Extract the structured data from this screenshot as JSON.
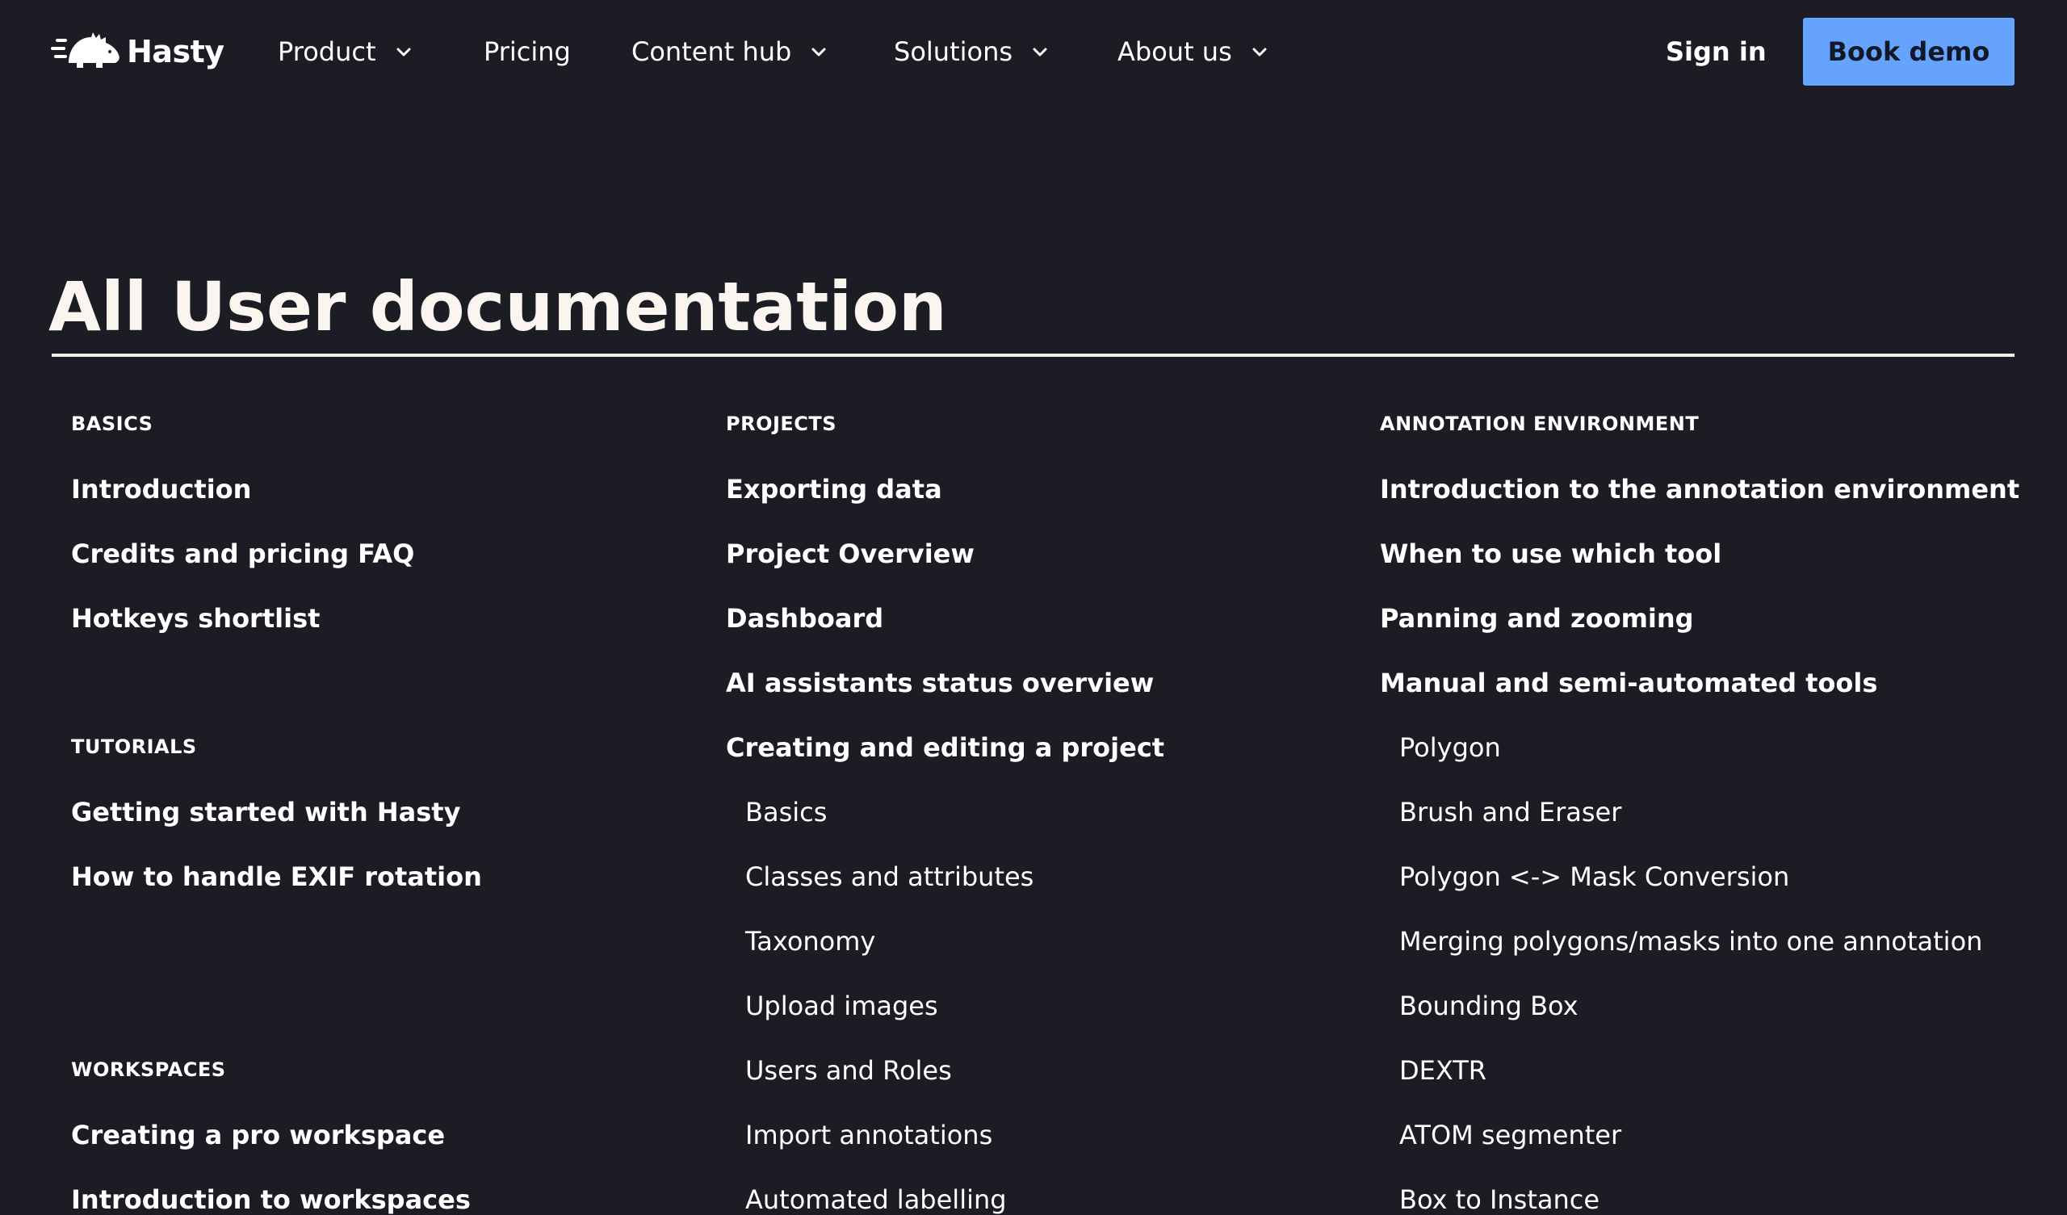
{
  "nav": {
    "logo_text": "Hasty",
    "items": [
      {
        "label": "Product",
        "has_dropdown": true
      },
      {
        "label": "Pricing",
        "has_dropdown": false
      },
      {
        "label": "Content hub",
        "has_dropdown": true
      },
      {
        "label": "Solutions",
        "has_dropdown": true
      },
      {
        "label": "About us",
        "has_dropdown": true
      }
    ],
    "sign_in": "Sign in",
    "book_demo": "Book demo"
  },
  "page": {
    "title": "All User documentation"
  },
  "colors": {
    "background": "#1b1c24",
    "accent": "#66a3ff",
    "title": "#fbf5ef"
  },
  "columns": [
    {
      "sections": [
        {
          "heading": "BASICS",
          "links": [
            "Introduction",
            "Credits and pricing FAQ",
            "Hotkeys shortlist"
          ]
        },
        {
          "heading": "TUTORIALS",
          "links": [
            "Getting started with Hasty",
            "How to handle EXIF rotation"
          ]
        },
        {
          "heading": "WORKSPACES",
          "links": [
            "Creating a pro workspace",
            "Introduction to workspaces"
          ]
        }
      ]
    },
    {
      "sections": [
        {
          "heading": "PROJECTS",
          "links": [
            "Exporting data",
            "Project Overview",
            "Dashboard",
            "AI assistants status overview",
            "Creating and editing a project"
          ],
          "sublinks": [
            "Basics",
            "Classes and attributes",
            "Taxonomy",
            "Upload images",
            "Users and Roles",
            "Import annotations",
            "Automated labelling"
          ]
        }
      ]
    },
    {
      "sections": [
        {
          "heading": "ANNOTATION ENVIRONMENT",
          "links": [
            "Introduction to the annotation environment",
            "When to use which tool",
            "Panning and zooming",
            "Manual and semi-automated tools"
          ],
          "sublinks": [
            "Polygon",
            "Brush and Eraser",
            "Polygon <-> Mask Conversion",
            "Merging polygons/masks into one annotation",
            "Bounding Box",
            "DEXTR",
            "ATOM segmenter",
            "Box to Instance"
          ]
        }
      ]
    }
  ]
}
